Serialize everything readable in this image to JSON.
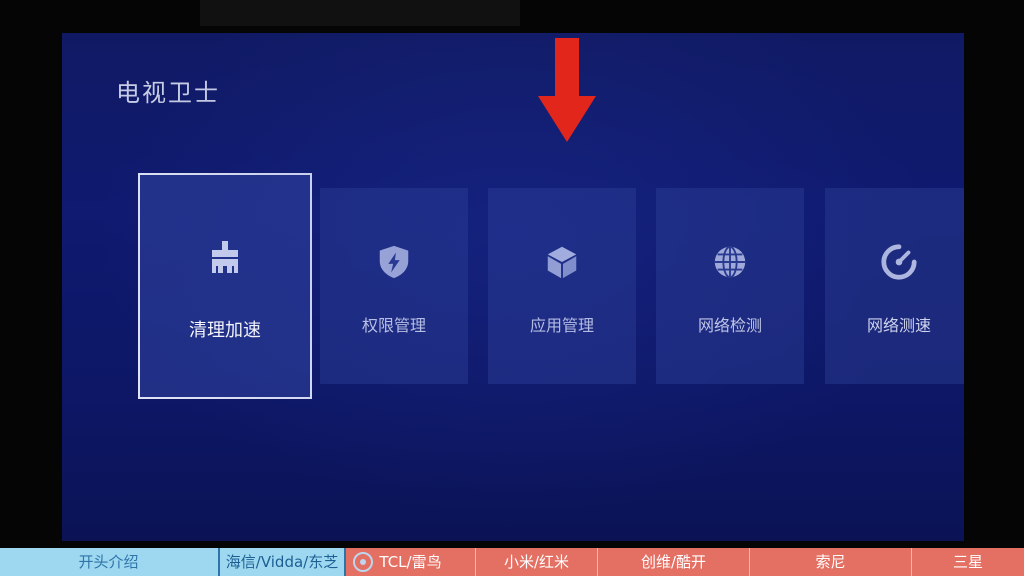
{
  "screen": {
    "title": "电视卫士"
  },
  "tiles": [
    {
      "label": "清理加速",
      "icon": "broom-icon",
      "focused": true
    },
    {
      "label": "权限管理",
      "icon": "shield-lightning-icon",
      "focused": false
    },
    {
      "label": "应用管理",
      "icon": "cube-icon",
      "focused": false
    },
    {
      "label": "网络检测",
      "icon": "globe-icon",
      "focused": false
    },
    {
      "label": "网络测速",
      "icon": "speedometer-icon",
      "focused": false
    }
  ],
  "annotation": {
    "arrow_color": "#e3261c",
    "arrow_direction": "down"
  },
  "chapters": [
    {
      "label": "开头介绍",
      "state": "watched"
    },
    {
      "label": "海信/Vidda/东芝",
      "state": "current"
    },
    {
      "label": "TCL/雷鸟",
      "state": "upcoming"
    },
    {
      "label": "小米/红米",
      "state": "upcoming"
    },
    {
      "label": "创维/酷开",
      "state": "upcoming"
    },
    {
      "label": "索尼",
      "state": "upcoming"
    },
    {
      "label": "三星",
      "state": "upcoming"
    }
  ],
  "colors": {
    "screen_bg": "#0f1a70",
    "tile_bg": "#28388c",
    "focus_border": "#dfe3f5",
    "chapter_upcoming": "#e46f63",
    "chapter_watched": "#9ed8f0"
  }
}
